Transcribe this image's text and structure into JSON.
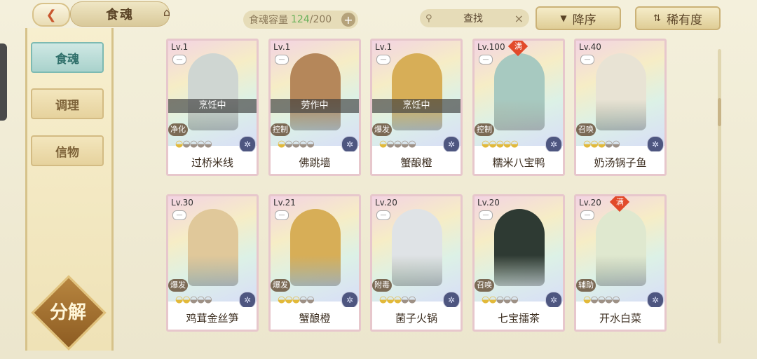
{
  "header": {
    "back_icon": "back-arrow-icon",
    "title": "食魂",
    "home_icon": "home-icon",
    "capacity_label": "食魂容量",
    "capacity_current": "124",
    "capacity_sep_max": "/200",
    "capacity_add": "+",
    "search_label": "查找",
    "search_clear": "×",
    "sort_order_label": "降序",
    "sort_rarity_label": "稀有度"
  },
  "sidebar": {
    "tabs": [
      {
        "label": "食魂",
        "active": true
      },
      {
        "label": "调理",
        "active": false
      },
      {
        "label": "信物",
        "active": false
      }
    ],
    "decompose_label": "分解"
  },
  "cards": [
    {
      "level": "Lv.1",
      "status": "烹饪中",
      "role": "净化",
      "stars_on": 1,
      "stars_total": 5,
      "name": "过桥米线",
      "max": false,
      "portrait": "#cfd6d2",
      "border": "#e7c7d2"
    },
    {
      "level": "Lv.1",
      "status": "劳作中",
      "role": "控制",
      "stars_on": 1,
      "stars_total": 5,
      "name": "佛跳墙",
      "max": false,
      "portrait": "#b5875a",
      "border": "#e7c7d2"
    },
    {
      "level": "Lv.1",
      "status": "烹饪中",
      "role": "爆发",
      "stars_on": 1,
      "stars_total": 5,
      "name": "蟹酿橙",
      "max": false,
      "portrait": "#d7ae57",
      "border": "#e7c7d2"
    },
    {
      "level": "Lv.100",
      "status": "",
      "role": "控制",
      "stars_on": 5,
      "stars_total": 5,
      "name": "糯米八宝鸭",
      "max": true,
      "max_label": "满",
      "portrait": "#a7c9c0",
      "border": "#e7c7d2"
    },
    {
      "level": "Lv.40",
      "status": "",
      "role": "召唤",
      "stars_on": 3,
      "stars_total": 5,
      "name": "奶汤锅子鱼",
      "max": false,
      "portrait": "#e8e3d4",
      "border": "#e7c7d2"
    },
    {
      "level": "Lv.30",
      "status": "",
      "role": "爆发",
      "stars_on": 2,
      "stars_total": 5,
      "name": "鸡茸金丝笋",
      "max": false,
      "portrait": "#e0c89a",
      "border": "#e7c7d2"
    },
    {
      "level": "Lv.21",
      "status": "",
      "role": "爆发",
      "stars_on": 3,
      "stars_total": 5,
      "name": "蟹酿橙",
      "max": false,
      "portrait": "#d7ae57",
      "border": "#e7c7d2"
    },
    {
      "level": "Lv.20",
      "status": "",
      "role": "附毒",
      "stars_on": 3,
      "stars_total": 5,
      "name": "菌子火锅",
      "max": false,
      "portrait": "#dfe3e6",
      "border": "#e7c7d2"
    },
    {
      "level": "Lv.20",
      "status": "",
      "role": "召唤",
      "stars_on": 2,
      "stars_total": 5,
      "name": "七宝擂茶",
      "max": false,
      "portrait": "#2e3a33",
      "border": "#e7c7d2"
    },
    {
      "level": "Lv.20",
      "status": "",
      "role": "辅助",
      "stars_on": 1,
      "stars_total": 5,
      "name": "开水白菜",
      "max": true,
      "max_label": "满",
      "portrait": "#dfe8cf",
      "border": "#e7c7d2"
    }
  ]
}
